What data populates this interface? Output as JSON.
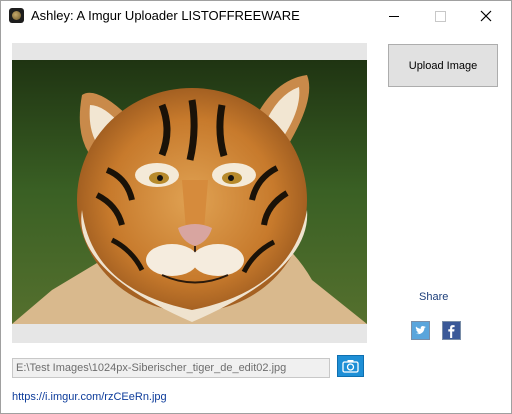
{
  "window": {
    "title": "Ashley: A Imgur Uploader",
    "watermark": "LISTOFFREEWARE"
  },
  "toolbar": {
    "upload_label": "Upload Image"
  },
  "share": {
    "label": "Share",
    "twitter_icon": "twitter-icon",
    "facebook_icon": "facebook-icon"
  },
  "file": {
    "path": "E:\\Test Images\\1024px-Siberischer_tiger_de_edit02.jpg"
  },
  "result": {
    "url": "https://i.imgur.com/rzCEeRn.jpg"
  },
  "colors": {
    "accent": "#1e8fd6",
    "twitter": "#5aa5dc",
    "facebook": "#3b5998",
    "link": "#0d3c9b"
  }
}
